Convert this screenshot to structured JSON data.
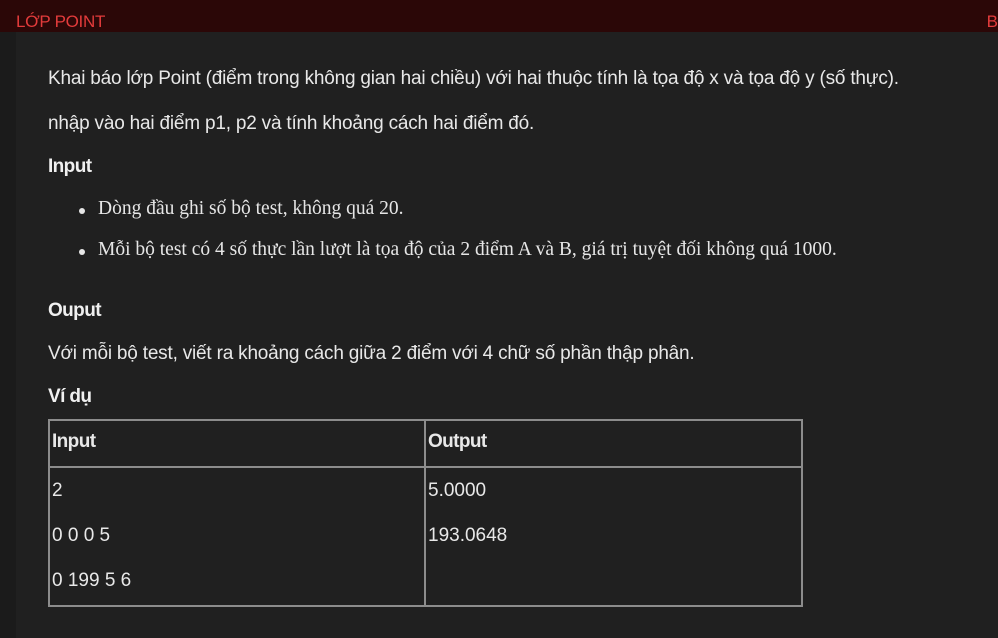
{
  "header": {
    "title": "LỚP POINT",
    "right_text": "B"
  },
  "problem": {
    "intro_line1": "Khai báo lớp Point (điểm trong không gian hai chiều) với hai thuộc tính là tọa độ x và tọa độ y (số thực).",
    "intro_line2": "nhập vào hai điểm p1, p2 và tính khoảng cách hai điểm đó.",
    "input_heading": "Input",
    "input_items": [
      "Dòng đầu ghi số bộ test, không quá 20.",
      "Mỗi bộ test có 4 số thực lần lượt là tọa độ của 2 điểm A và B, giá trị tuyệt đối không quá 1000."
    ],
    "output_heading": "Ouput",
    "output_text": "Với mỗi bộ test, viết ra khoảng cách giữa 2 điểm với 4 chữ số phần thập phân.",
    "example_heading": "Ví dụ"
  },
  "example_table": {
    "headers": [
      "Input",
      "Output"
    ],
    "input_lines": [
      "2",
      "0 0 0 5",
      "0 199 5 6"
    ],
    "output_lines": [
      "5.0000",
      "193.0648"
    ]
  }
}
